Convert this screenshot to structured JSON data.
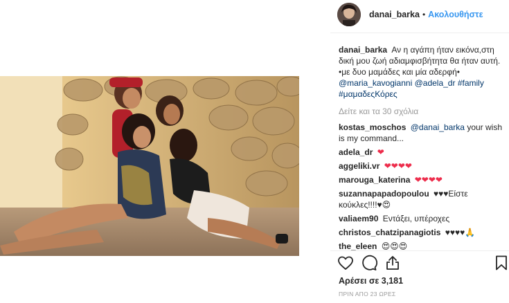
{
  "post": {
    "username": "danai_barka",
    "separator": "•",
    "follow_label": "Ακολουθήστε",
    "caption": {
      "username": "danai_barka",
      "text_part1": "Αν η αγάπη ήταν εικόνα,στη δική μου ζωή αδιαμφισβήτητα θα ήταν αυτή. •με δυο μαμάδες και μία αδερφή•",
      "mention1": "@maria_kavogianni",
      "mention2": "@adela_dr",
      "hashtag1": "#family",
      "hashtag2": "#μαμαδεςΚόρες"
    },
    "view_more": "Δείτε και τα 30 σχόλια",
    "comments": [
      {
        "user": "kostas_moschos",
        "mention": "@danai_barka",
        "text": "your wish is my command..."
      },
      {
        "user": "adela_dr",
        "text": "❤"
      },
      {
        "user": "aggeliki.vr",
        "text": "❤❤❤❤"
      },
      {
        "user": "marouga_katerina",
        "text": "❤❤❤❤"
      },
      {
        "user": "suzannapapadopoulou",
        "text": "♥♥♥Είστε κούκλες!!!!♥😍"
      },
      {
        "user": "valiaem90",
        "text": "Εντάξει, υπέροχες"
      },
      {
        "user": "christos_chatzipanagiotis",
        "text": "♥♥♥♥🙏"
      },
      {
        "user": "the_eleen",
        "text": "😍😍😍"
      }
    ],
    "likes_label": "Αρέσει σε 3,181",
    "timestamp": "ΠΡΙΝ ΑΠΟ 23 ΩΡΕΣ",
    "icons": {
      "like": "heart-icon",
      "comment": "comment-icon",
      "share": "share-icon",
      "save": "bookmark-icon"
    },
    "colors": {
      "link": "#3897f0",
      "mention": "#003569",
      "heart": "#ed2c4b",
      "muted": "#999999"
    }
  }
}
